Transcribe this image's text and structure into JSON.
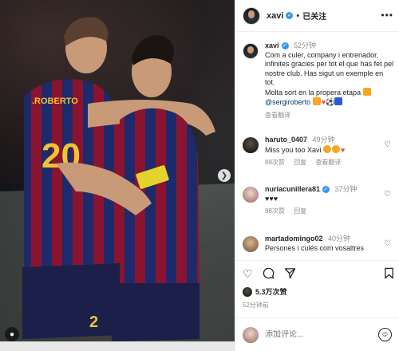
{
  "post_header": {
    "username": "xavi",
    "dot": "•",
    "follow_status": "已关注",
    "more": "•••"
  },
  "comments": [
    {
      "username": "xavi",
      "time": "52分钟",
      "text": "Com a culer, company i entrenador, infinites gràcies per tot el que has fet pel nostre club. Has sigut un exemple en tot.",
      "text2": "Molta sort en la propera etapa",
      "mention": "@sergiroberto",
      "see_translation": "查看翻译"
    },
    {
      "username": "haruto_0407",
      "time": "49分钟",
      "text": "Miss you too Xavi",
      "likes": "88次赞",
      "reply": "回复",
      "see_translation": "查看翻译"
    },
    {
      "username": "nuriacunillera81",
      "time": "37分钟",
      "text": "♥♥♥",
      "likes": "88次赞",
      "reply": "回复"
    },
    {
      "username": "martadomingo02",
      "time": "40分钟",
      "text": "Persones i culés com vosaltres"
    }
  ],
  "actions": {
    "like_icon": "heart-icon",
    "comment_icon": "comment-icon",
    "share_icon": "share-icon",
    "save_icon": "bookmark-icon"
  },
  "likes_count": "5.3万次赞",
  "posted_time": "52分钟前",
  "comment_input": {
    "placeholder": "添加评论..."
  },
  "colors": {
    "verified": "#3897f0",
    "heart_red": "#ed4956",
    "mention": "#00376b",
    "muted": "#8e8e8e"
  }
}
